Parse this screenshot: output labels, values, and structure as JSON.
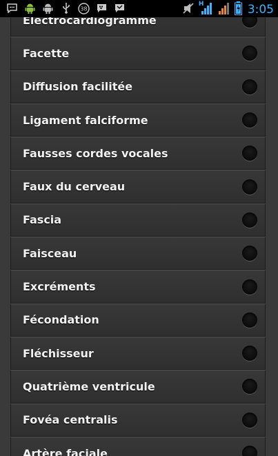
{
  "status_bar": {
    "time": "3:05",
    "network_type": "H",
    "icons": [
      "chat-icon",
      "android-icon",
      "android-debug-icon",
      "usb-icon",
      "counter-badge-icon",
      "bbm-icon",
      "chat-bubble-icon",
      "mute-icon",
      "signal-icon",
      "signal-icon-2",
      "battery-icon"
    ],
    "badge_count": "38",
    "accent_color": "#3ab4ff"
  },
  "list": {
    "items": [
      {
        "label": "Électrocardiogramme"
      },
      {
        "label": "Facette"
      },
      {
        "label": "Diffusion facilitée"
      },
      {
        "label": "Ligament falciforme"
      },
      {
        "label": "Fausses cordes vocales"
      },
      {
        "label": "Faux du cerveau"
      },
      {
        "label": "Fascia"
      },
      {
        "label": "Faisceau"
      },
      {
        "label": "Excréments"
      },
      {
        "label": "Fécondation"
      },
      {
        "label": "Fléchisseur"
      },
      {
        "label": "Quatrième ventricule"
      },
      {
        "label": "Fovéa centralis"
      },
      {
        "label": "Artère faciale"
      }
    ]
  }
}
